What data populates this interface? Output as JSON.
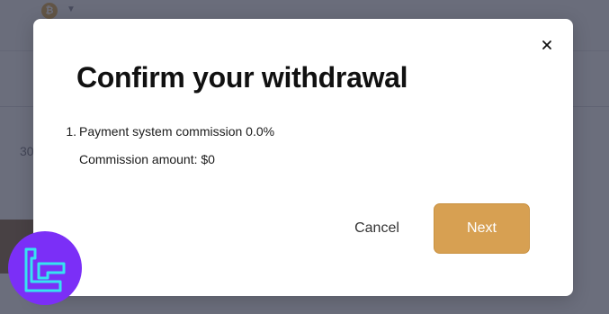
{
  "background": {
    "coin_symbol": "₿",
    "partial_text": "30"
  },
  "modal": {
    "title": "Confirm your withdrawal",
    "list_number": "1.",
    "commission_rate_text": "Payment system commission 0.0%",
    "commission_amount_text": "Commission amount: $0",
    "cancel_label": "Cancel",
    "next_label": "Next",
    "close_icon": "close-icon"
  },
  "colors": {
    "next_button": "#d7a052",
    "overlay": "#2a2d42",
    "logo": "#7b2ff7"
  }
}
